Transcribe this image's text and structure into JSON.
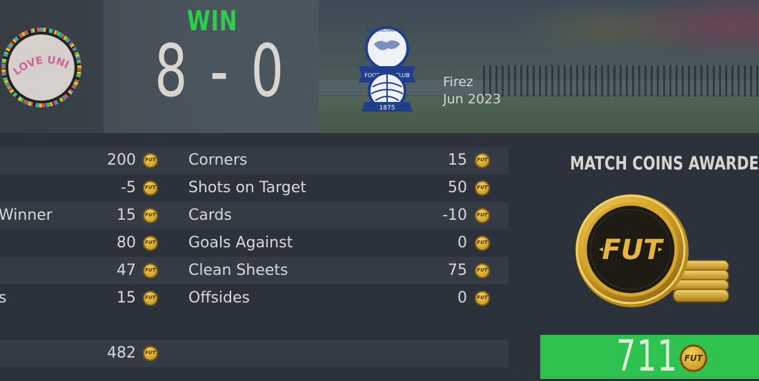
{
  "match": {
    "result_label": "WIN",
    "score": "8 - 0",
    "opponent_name": "Firez",
    "date": "Jun 2023",
    "home_badge_text": "LOVE UNITES",
    "away_badge_text": [
      "BIRMINGHAM CITY",
      "FOOTBALL CLUB",
      "1875"
    ]
  },
  "stats_left": [
    {
      "label": "",
      "value": "200"
    },
    {
      "label": "",
      "value": "-5"
    },
    {
      "label": "Winner",
      "value": "15"
    },
    {
      "label": "",
      "value": "80"
    },
    {
      "label": "",
      "value": "47"
    },
    {
      "label": "s",
      "value": "15"
    }
  ],
  "stats_right": [
    {
      "label": "Corners",
      "value": "15"
    },
    {
      "label": "Shots on Target",
      "value": "50"
    },
    {
      "label": "Cards",
      "value": "-10"
    },
    {
      "label": "Goals Against",
      "value": "0"
    },
    {
      "label": "Clean Sheets",
      "value": "75"
    },
    {
      "label": "Offsides",
      "value": "0"
    }
  ],
  "subtotal": {
    "value": "482"
  },
  "awards": {
    "title": "MATCH COINS AWARDED",
    "coin_label": "FUT",
    "total": "711"
  },
  "colors": {
    "win_green": "#2bd04a",
    "award_bar": "#30c24f",
    "coin_gold": "#d6a72c"
  }
}
